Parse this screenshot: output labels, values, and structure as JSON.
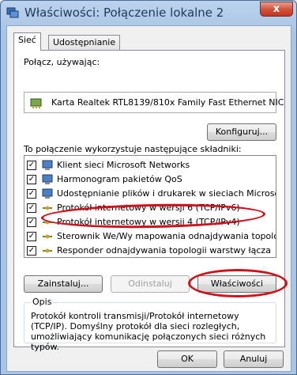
{
  "window": {
    "title": "Właściwości: Połączenie lokalne 2",
    "close_glyph": "x"
  },
  "tabs": [
    {
      "label": "Sieć",
      "active": true
    },
    {
      "label": "Udostępnianie",
      "active": false
    }
  ],
  "connect_using": {
    "label": "Połącz, używając:",
    "adapter": "Karta Realtek RTL8139/810x Family Fast Ethernet NIC",
    "adapter_icon": "network-adapter-icon",
    "configure_button": "Konfiguruj..."
  },
  "components": {
    "label": "To połączenie wykorzystuje następujące składniki:",
    "items": [
      {
        "label": "Klient sieci Microsoft Networks",
        "checked": true,
        "icon": "client-icon"
      },
      {
        "label": "Harmonogram pakietów QoS",
        "checked": true,
        "icon": "service-icon"
      },
      {
        "label": "Udostępnianie plików i drukarek w sieciach Microsoft N...",
        "checked": true,
        "icon": "service-icon"
      },
      {
        "label": "Protokół internetowy w wersji 6 (TCP/IPv6)",
        "checked": true,
        "icon": "protocol-icon"
      },
      {
        "label": "Protokół internetowy w wersji 4 (TCP/IPv4)",
        "checked": true,
        "icon": "protocol-icon"
      },
      {
        "label": "Sterownik We/Wy mapowania odnajdywania topolo...",
        "checked": true,
        "icon": "protocol-icon"
      },
      {
        "label": "Responder odnajdywania topologii warstwy łącza",
        "checked": true,
        "icon": "protocol-icon"
      }
    ]
  },
  "buttons": {
    "install": "Zainstaluj...",
    "uninstall": "Odinstaluj",
    "properties": "Właściwości",
    "ok": "OK",
    "cancel": "Anuluj"
  },
  "description": {
    "title": "Opis",
    "text": "Protokół kontroli transmisji/Protokół internetowy (TCP/IP). Domyślny protokół dla sieci rozległych, umożliwiający komunikację połączonych sieci różnych typów."
  },
  "colors": {
    "highlight": "#d0101a",
    "title_text": "#1e395b"
  }
}
